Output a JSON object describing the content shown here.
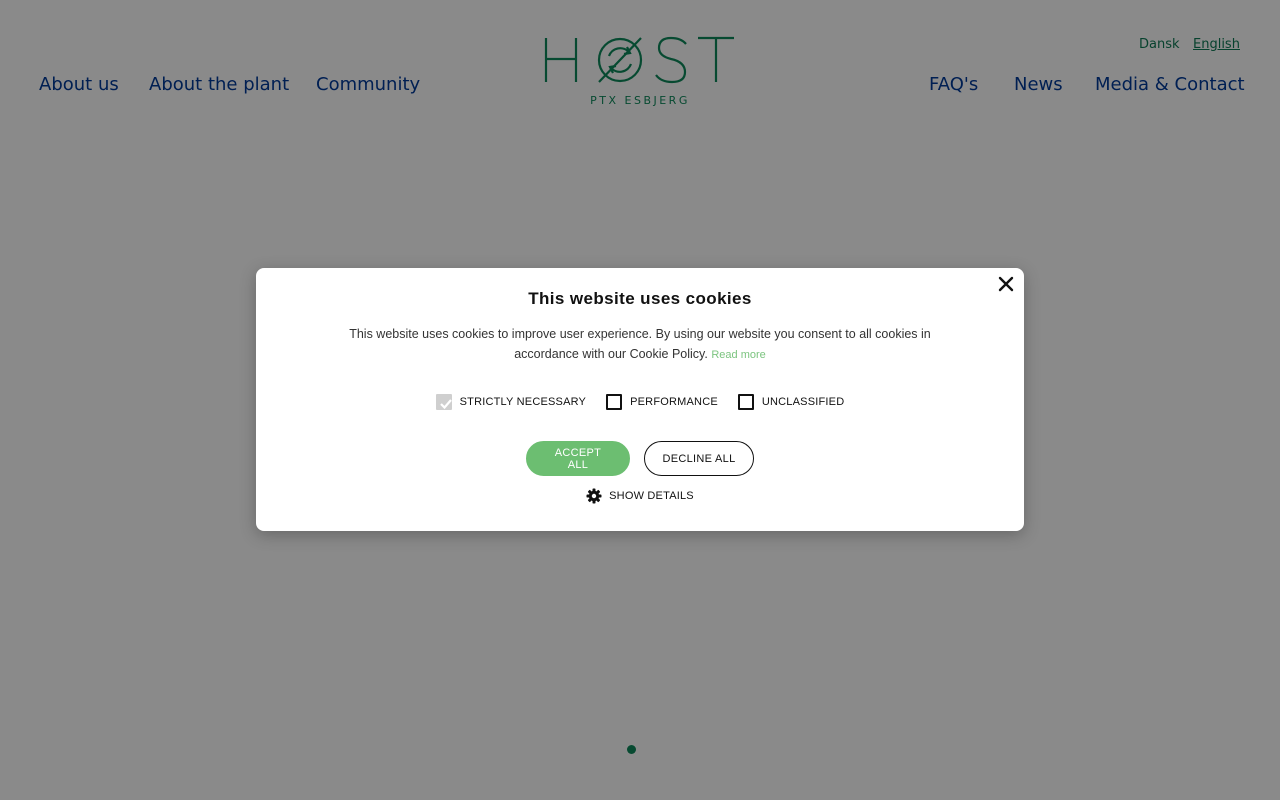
{
  "header": {
    "nav_left": [
      {
        "label": "About us"
      },
      {
        "label": "About the plant"
      },
      {
        "label": "Community"
      }
    ],
    "nav_right": [
      {
        "label": "FAQ's"
      },
      {
        "label": "News"
      },
      {
        "label": "Media & Contact"
      }
    ],
    "languages": [
      {
        "label": "Dansk",
        "active": false
      },
      {
        "label": "English",
        "active": true
      }
    ],
    "logo": {
      "wordmark": "HØST",
      "subtitle": "PTX ESBJERG",
      "icon": "recycle-arrows-icon"
    }
  },
  "cookie_dialog": {
    "title": "This website uses cookies",
    "body": "This website uses cookies to improve user experience. By using our website you consent to all cookies in accordance with our Cookie Policy.",
    "read_more": "Read more",
    "options": [
      {
        "label": "STRICTLY NECESSARY",
        "checked": true,
        "disabled": true
      },
      {
        "label": "PERFORMANCE",
        "checked": false,
        "disabled": false
      },
      {
        "label": "UNCLASSIFIED",
        "checked": false,
        "disabled": false
      }
    ],
    "accept_label": "ACCEPT ALL",
    "decline_label": "DECLINE ALL",
    "show_details_label": "SHOW DETAILS",
    "close_icon": "close-icon",
    "details_icon": "gear-icon"
  },
  "colors": {
    "nav_text": "#003a99",
    "brand_green": "#0e8a5c",
    "accept_green": "#6cbe71",
    "read_more_green": "#7bc47f"
  }
}
